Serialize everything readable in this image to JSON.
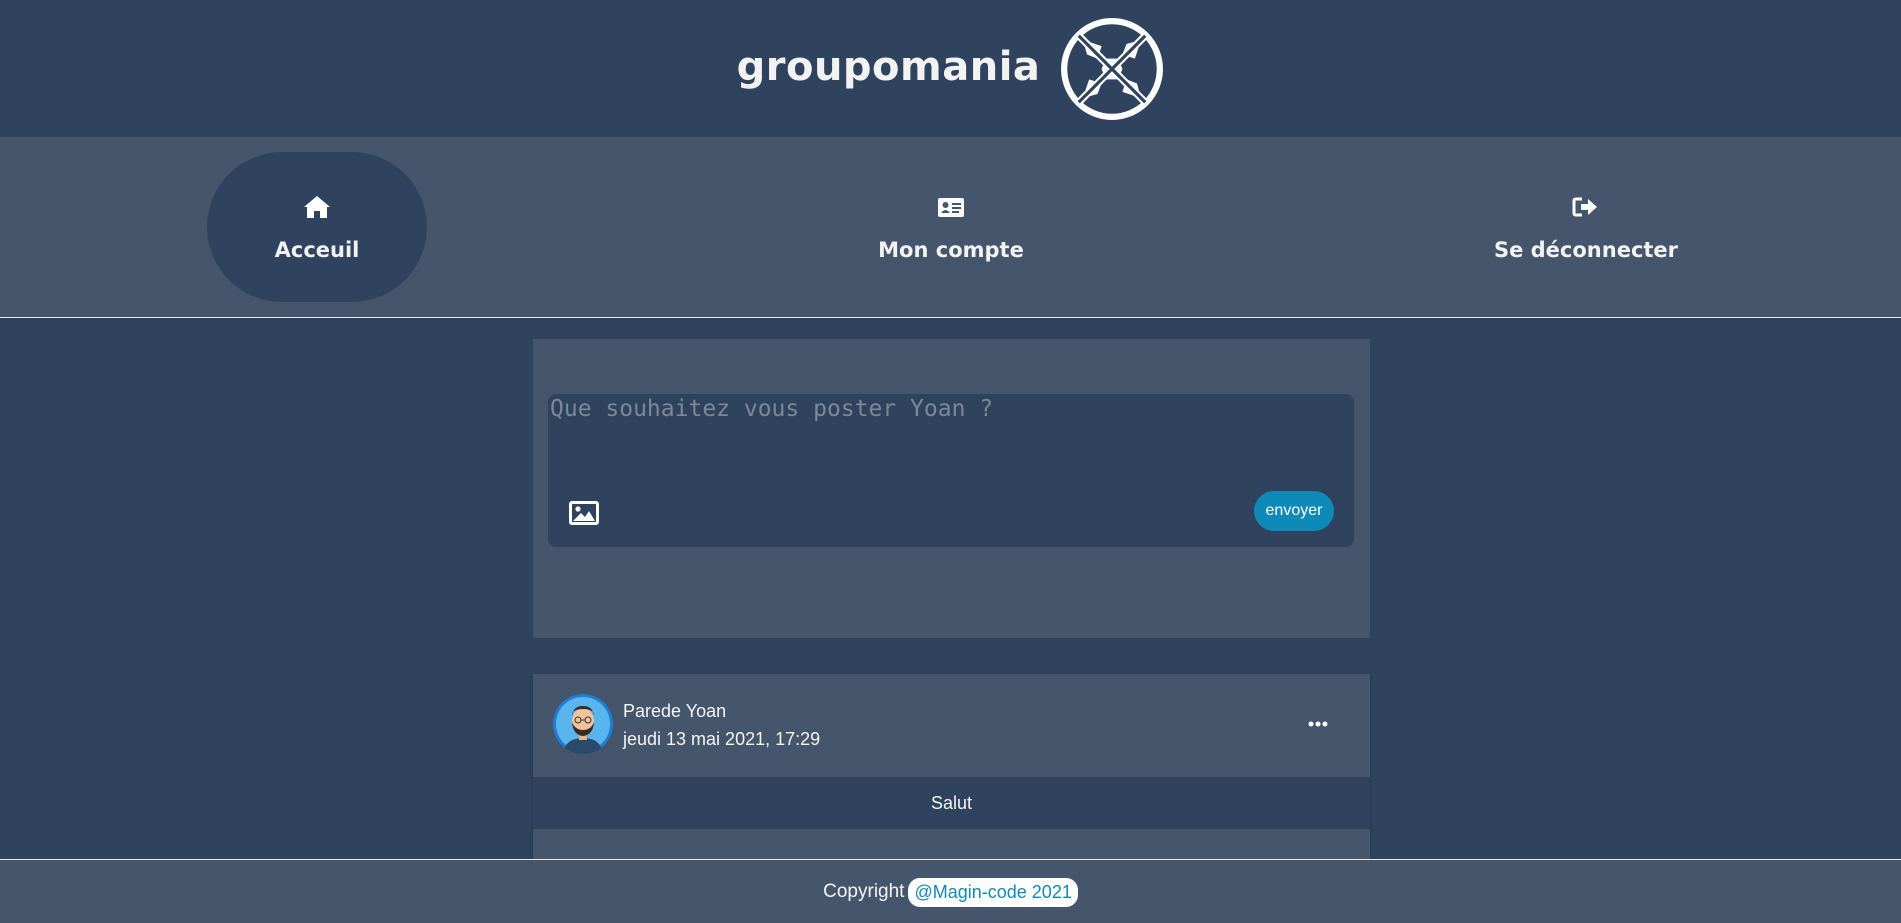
{
  "header": {
    "brand": "groupomania",
    "logo_icon": "globe-logo-icon"
  },
  "nav": {
    "items": [
      {
        "label": "Acceuil",
        "icon": "home-icon",
        "active": true
      },
      {
        "label": "Mon compte",
        "icon": "id-card-icon",
        "active": false
      },
      {
        "label": "Se déconnecter",
        "icon": "sign-out-icon",
        "active": false
      }
    ]
  },
  "composer": {
    "placeholder": "Que souhaitez vous poster Yoan ?",
    "value": "",
    "image_icon": "image-icon",
    "send_label": "envoyer"
  },
  "posts": [
    {
      "author": "Parede Yoan",
      "date": "jeudi 13 mai 2021, 17:29",
      "content": "Salut",
      "more_icon": "ellipsis-icon"
    }
  ],
  "footer": {
    "text": "Copyright",
    "link_label": "@Magin-code 2021"
  },
  "colors": {
    "background": "#2f435e",
    "panel": "#45566c",
    "accent": "#0e8ab9",
    "text": "#f5f5f5"
  }
}
